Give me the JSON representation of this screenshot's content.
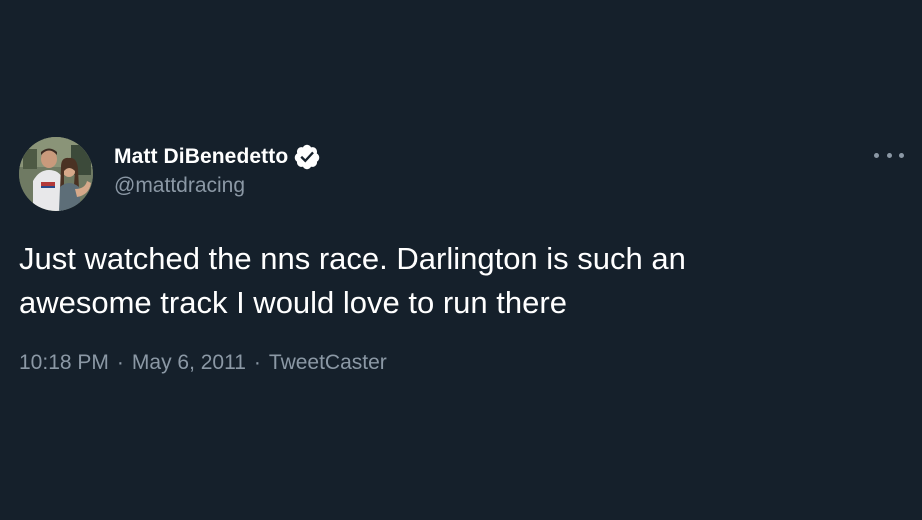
{
  "author": {
    "display_name": "Matt DiBenedetto",
    "handle": "@mattdracing",
    "verified": true
  },
  "tweet": {
    "text": "Just watched the nns race. Darlington is such an\nawesome track I would love to run there",
    "time": "10:18 PM",
    "date": "May 6, 2011",
    "source": "TweetCaster",
    "separator": "·"
  },
  "icons": {
    "verified": "verified-badge-icon",
    "more": "more-options-icon"
  },
  "colors": {
    "background": "#15202b",
    "text": "#ffffff",
    "secondary_text": "#8b98a5"
  }
}
